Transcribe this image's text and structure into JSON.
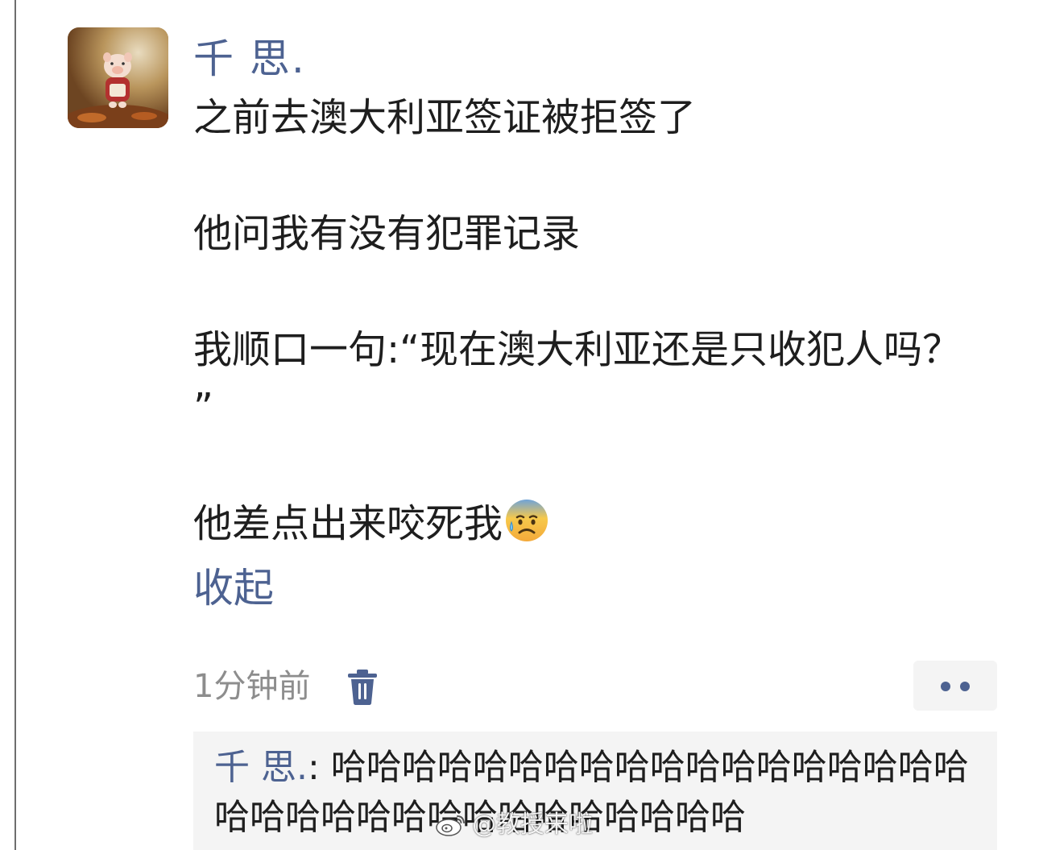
{
  "comment": {
    "username": "千 思.",
    "paragraphs": [
      "之前去澳大利亚签证被拒签了",
      "他问我有没有犯罪记录",
      "我顺口一句:“现在澳大利亚还是只收犯人吗？ ”",
      "他差点出来咬死我"
    ],
    "emoji": "anxious-face-with-sweat",
    "collapse_label": "收起",
    "timestamp": "1分钟前",
    "delete_icon": "trash-icon",
    "more_icon": "more-dots-icon"
  },
  "reply": {
    "author": "千 思.",
    "separator": ": ",
    "text": "哈哈哈哈哈哈哈哈哈哈哈哈哈哈哈哈哈哈哈哈哈哈哈哈哈哈哈哈哈哈哈哈哈"
  },
  "watermark": {
    "text": "@教授来啦",
    "icon": "weibo-logo-icon"
  },
  "colors": {
    "link_blue": "#4d6291",
    "text": "#1e1e1e",
    "meta_gray": "#8d8d8d",
    "reply_bg": "#f4f4f4"
  }
}
